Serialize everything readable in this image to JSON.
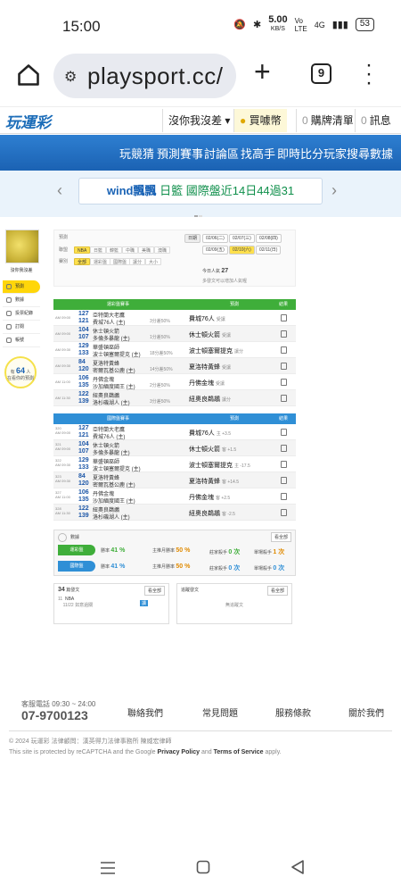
{
  "status": {
    "time": "15:00",
    "speed": "5.00",
    "speed_unit": "KB/S",
    "net": "4G",
    "battery": "53"
  },
  "browser": {
    "url": "playsport.cc/",
    "tab_count": "9"
  },
  "site_nav": {
    "logo": "玩運彩",
    "user": "沒你我沒差",
    "coin": "買噱幣",
    "cart_count": "0",
    "cart": "購牌清單",
    "msg_count": "0",
    "msg": "訊息"
  },
  "menu": [
    "玩競猜",
    "預測賽事",
    "討論區",
    "找高手",
    "即時比分",
    "玩家搜尋",
    "數據"
  ],
  "announce": {
    "name": "wind飄飄",
    "league": "日籃",
    "text": "國際盤近14日44過31"
  },
  "profile": {
    "nickname": "沒你我沒差",
    "online_label": "有",
    "online_count": "64",
    "online_suffix": "人",
    "online_sub": "在看你的預測"
  },
  "sidebar": [
    "預測",
    "數據",
    "投票紀錄",
    "訂閱",
    "帳號"
  ],
  "filters": {
    "row1_label": "預測",
    "row2_label": "聯盟",
    "row3_label": "賽別",
    "leagues": [
      "NBA",
      "日籃",
      "韓籃",
      "中職",
      "美職",
      "澳職"
    ],
    "types": [
      "全部",
      "運彩盤",
      "國際盤",
      "讓分",
      "大小"
    ],
    "date_label": "日期",
    "dates": [
      "02/06(二)",
      "02/07(三)",
      "02/08(四)",
      "02/09(五)",
      "02/10(六)",
      "02/11(日)"
    ],
    "today_label": "今日人氣",
    "today_count": "27",
    "note": "多發文可以增加人氣喔"
  },
  "section1": {
    "h1": "運彩盤賽事",
    "h2": "預測",
    "h3": "結果"
  },
  "section2": {
    "h1": "國際盤賽事",
    "h2": "預測",
    "h3": "結果"
  },
  "games1": [
    {
      "time": "AM 09:00",
      "n1": "127",
      "t1": "亞特蘭大老鷹",
      "n2": "121",
      "t2": "費城76人 (主)",
      "hint": "3分差50%",
      "pick": "費城76人",
      "pick_s": "受讓"
    },
    {
      "time": "AM 09:00",
      "n1": "104",
      "t1": "休士頓火箭",
      "n2": "107",
      "t2": "多倫多暴龍 (主)",
      "hint": "1分差50%",
      "pick": "休士頓火箭",
      "pick_s": "受讓"
    },
    {
      "time": "AM 09:30",
      "n1": "129",
      "t1": "華盛頓巫師",
      "n2": "133",
      "t2": "波士頓塞爾提克 (主)",
      "hint": "18分差50%",
      "pick": "波士頓塞爾提克",
      "pick_s": "讓分"
    },
    {
      "time": "AM 09:30",
      "n1": "84",
      "t1": "夏洛特黃蜂",
      "n2": "120",
      "t2": "密爾瓦基公鹿 (主)",
      "hint": "14分差50%",
      "pick": "夏洛特黃蜂",
      "pick_s": "受讓"
    },
    {
      "time": "AM 11:00",
      "n1": "106",
      "t1": "丹佛金塊",
      "n2": "135",
      "t2": "沙加緬度國王 (主)",
      "hint": "2分差50%",
      "pick": "丹佛金塊",
      "pick_s": "受讓"
    },
    {
      "time": "AM 11:30",
      "n1": "122",
      "t1": "紐奧良鵜鶘",
      "n2": "139",
      "t2": "洛杉磯湖人 (主)",
      "hint": "3分差50%",
      "pick": "紐奧良鵜鶘",
      "pick_s": "讓分"
    }
  ],
  "games2": [
    {
      "time": "AM 09:00",
      "id": "320",
      "n1": "127",
      "t1": "亞特蘭大老鷹",
      "n2": "121",
      "t2": "費城76人 (主)",
      "pick": "費城76人",
      "pick_s": "主 +3.5"
    },
    {
      "time": "AM 09:00",
      "id": "321",
      "n1": "104",
      "t1": "休士頓火箭",
      "n2": "107",
      "t2": "多倫多暴龍 (主)",
      "pick": "休士頓火箭",
      "pick_s": "客 +1.5"
    },
    {
      "time": "AM 09:30",
      "id": "322",
      "n1": "129",
      "t1": "華盛頓巫師",
      "n2": "133",
      "t2": "波士頓塞爾提克 (主)",
      "pick": "波士頓塞爾提克",
      "pick_s": "主 -17.5"
    },
    {
      "time": "AM 09:30",
      "id": "323",
      "n1": "84",
      "t1": "夏洛特黃蜂",
      "n2": "120",
      "t2": "密爾瓦基公鹿 (主)",
      "pick": "夏洛特黃蜂",
      "pick_s": "客 +14.5"
    },
    {
      "time": "AM 11:00",
      "id": "327",
      "n1": "106",
      "t1": "丹佛金塊",
      "n2": "135",
      "t2": "沙加緬度國王 (主)",
      "pick": "丹佛金塊",
      "pick_s": "客 +2.5"
    },
    {
      "time": "AM 11:30",
      "id": "328",
      "n1": "122",
      "t1": "紐奧良鵜鶘",
      "n2": "139",
      "t2": "洛杉磯湖人 (主)",
      "pick": "紐奧良鵜鶘",
      "pick_s": "客 -2.5"
    }
  ],
  "stats": {
    "title": "數據",
    "more": "看全部",
    "l1": "運彩盤",
    "l2": "國際盤",
    "win_label": "勝率",
    "win1": "41 %",
    "win2": "41 %",
    "main_label": "主推月勝率",
    "main1": "50 %",
    "main2": "50 %",
    "kill_label": "莊家殺手",
    "kill1": "0 次",
    "kill2": "0 次",
    "hot_label": "單場殺手",
    "hot1": "1 次",
    "hot2": "0 次"
  },
  "boxes": {
    "left_count": "34",
    "left_title": "篇發文",
    "left_more": "看全部",
    "left_item_count": "11",
    "left_item_league": "NBA",
    "left_item_text": "11/22 如意過關",
    "left_item_tag": "讀",
    "right_title": "追蹤發文",
    "right_more": "看全部",
    "right_empty": "無追蹤文"
  },
  "footer": {
    "tel_label": "客服電話 09:30 ~ 24:00",
    "tel": "07-9700123",
    "links": [
      "聯絡我們",
      "常見問題",
      "服務條款",
      "關於我們"
    ],
    "copyright": "© 2024 玩運彩 法律顧問：漢英得力法律事務所 陳威宏律師",
    "recaptcha_pre": "This site is protected by reCAPTCHA and the Google",
    "privacy": "Privacy Policy",
    "and": "and",
    "terms": "Terms of Service",
    "apply": "apply."
  }
}
